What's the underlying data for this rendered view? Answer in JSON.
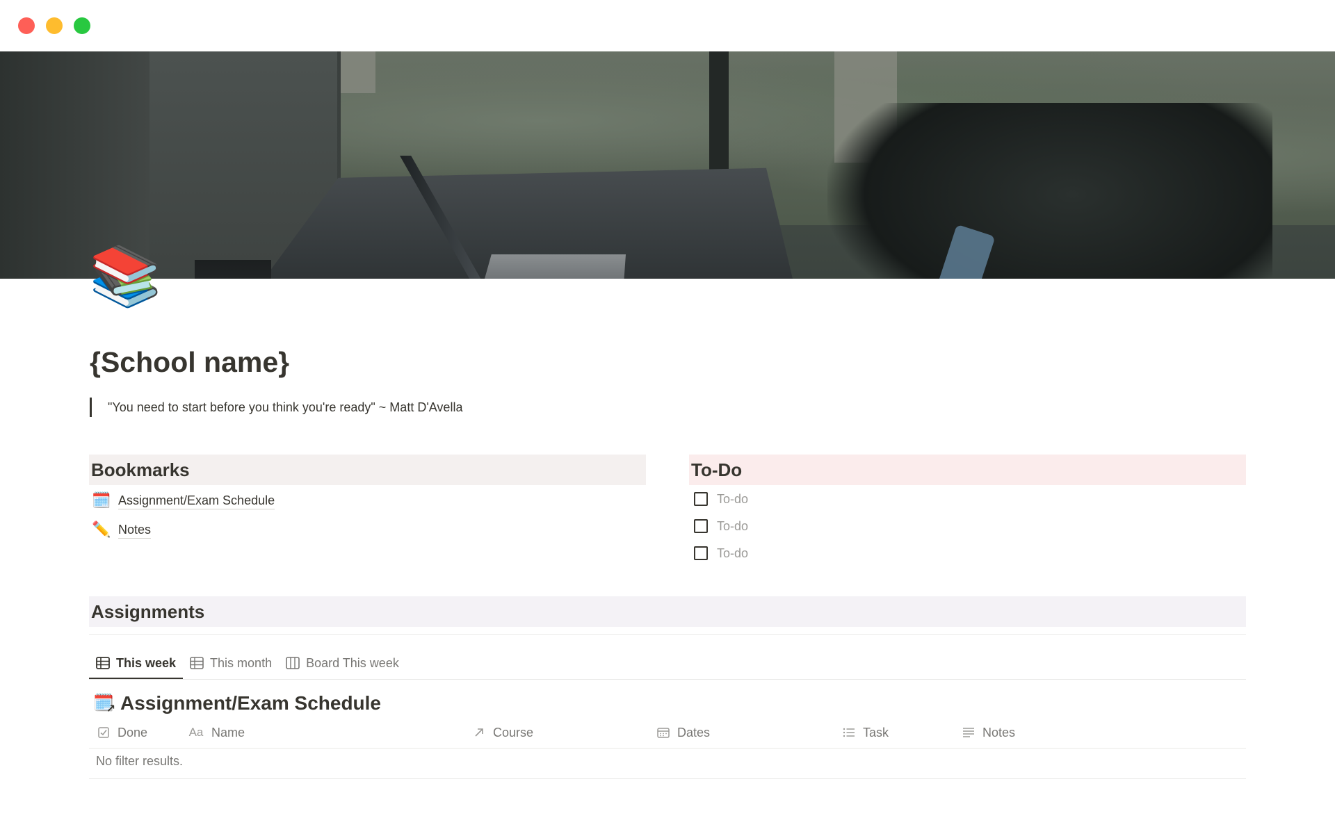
{
  "window": {
    "controls": [
      "close",
      "minimize",
      "zoom"
    ]
  },
  "page": {
    "icon": "📚",
    "title": "{School name}",
    "quote": "\"You need to start before you think you're ready\" ~ Matt D'Avella"
  },
  "bookmarks": {
    "title": "Bookmarks",
    "items": [
      {
        "icon": "🗓️",
        "label": "Assignment/Exam Schedule"
      },
      {
        "icon": "✏️",
        "label": "Notes"
      }
    ]
  },
  "todo": {
    "title": "To-Do",
    "items": [
      {
        "label": "To-do",
        "checked": false
      },
      {
        "label": "To-do",
        "checked": false
      },
      {
        "label": "To-do",
        "checked": false
      }
    ]
  },
  "assignments": {
    "title": "Assignments",
    "tabs": [
      {
        "label": "This week",
        "icon": "table-icon",
        "active": true
      },
      {
        "label": "This month",
        "icon": "table-icon",
        "active": false
      },
      {
        "label": "Board This week",
        "icon": "board-icon",
        "active": false
      }
    ],
    "database": {
      "icon": "🗓️",
      "title": "Assignment/Exam Schedule",
      "columns": [
        {
          "label": "Done",
          "icon": "checkbox-icon"
        },
        {
          "label": "Name",
          "icon": "text-type-icon",
          "icon_text": "Aa"
        },
        {
          "label": "Course",
          "icon": "relation-arrow-icon"
        },
        {
          "label": "Dates",
          "icon": "calendar-icon"
        },
        {
          "label": "Task",
          "icon": "list-icon"
        },
        {
          "label": "Notes",
          "icon": "lines-icon"
        }
      ],
      "empty_text": "No filter results."
    }
  },
  "colors": {
    "bookmarks_bg": "#f4f0ef",
    "todo_bg": "#fbecec",
    "assignments_bg": "#f4f2f6",
    "text": "#37352f",
    "muted": "#787774"
  }
}
